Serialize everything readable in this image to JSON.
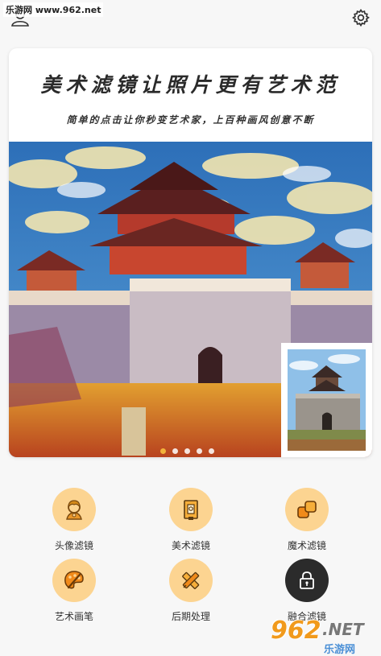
{
  "watermark_top": "乐游网 www.962.net",
  "banner": {
    "title": "美术滤镜让照片更有艺术范",
    "subtitle": "简单的点击让你秒变艺术家，上百种画风创意不断",
    "carousel_dots": 5,
    "active_dot": 0
  },
  "menu": {
    "items": [
      {
        "label": "头像滤镜",
        "icon": "avatar-filter-icon"
      },
      {
        "label": "美术滤镜",
        "icon": "art-filter-icon"
      },
      {
        "label": "魔术滤镜",
        "icon": "magic-filter-icon"
      },
      {
        "label": "艺术画笔",
        "icon": "palette-brush-icon"
      },
      {
        "label": "后期处理",
        "icon": "pencil-ruler-icon"
      },
      {
        "label": "融合滤镜",
        "icon": "lock-icon"
      }
    ]
  },
  "watermark_bottom": {
    "main": "962",
    "net": ".NET",
    "sub": "乐游网"
  },
  "colors": {
    "accent": "#fcd491",
    "dark_icon_bg": "#2b2b2b",
    "background": "#f7f7f7"
  }
}
